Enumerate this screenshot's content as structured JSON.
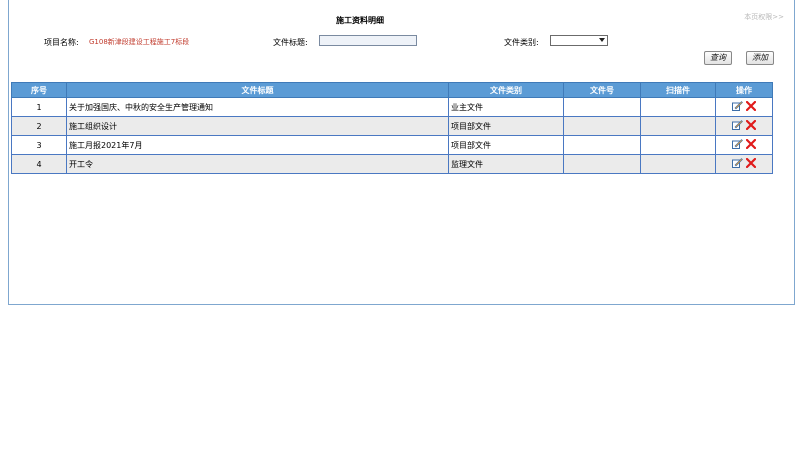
{
  "header": {
    "title": "施工资料明细",
    "perm_link": "本页权限>>"
  },
  "filters": {
    "project_label": "项目名称:",
    "project_value": "G108新津段建设工程施工7标段",
    "title_label": "文件标题:",
    "title_value": "",
    "type_label": "文件类别:",
    "type_value": ""
  },
  "buttons": {
    "search": "查询",
    "add": "添加"
  },
  "table": {
    "columns": [
      "序号",
      "文件标题",
      "文件类别",
      "文件号",
      "扫描件",
      "操作"
    ],
    "rows": [
      {
        "no": "1",
        "title": "关于加强国庆、中秋的安全生产管理通知",
        "category": "业主文件",
        "doc_no": "",
        "scan": ""
      },
      {
        "no": "2",
        "title": "施工组织设计",
        "category": "项目部文件",
        "doc_no": "",
        "scan": ""
      },
      {
        "no": "3",
        "title": "施工月报2021年7月",
        "category": "项目部文件",
        "doc_no": "",
        "scan": ""
      },
      {
        "no": "4",
        "title": "开工令",
        "category": "监理文件",
        "doc_no": "",
        "scan": ""
      }
    ],
    "row_icons": [
      "edit-icon",
      "delete-icon"
    ]
  },
  "colors": {
    "header_bg": "#5b9bd5",
    "project_text": "#c0392b",
    "delete_icon": "#e01b1b"
  }
}
